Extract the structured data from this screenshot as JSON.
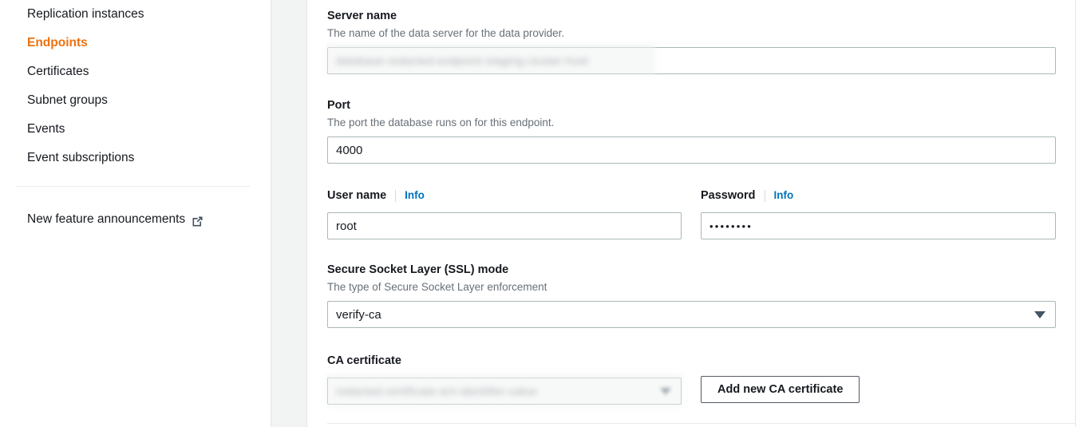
{
  "sidebar": {
    "items": [
      {
        "label": "Replication instances",
        "active": false
      },
      {
        "label": "Endpoints",
        "active": true
      },
      {
        "label": "Certificates",
        "active": false
      },
      {
        "label": "Subnet groups",
        "active": false
      },
      {
        "label": "Events",
        "active": false
      },
      {
        "label": "Event subscriptions",
        "active": false
      }
    ],
    "footer_link": {
      "label": "New feature announcements",
      "icon": "external-link-icon"
    },
    "active_color": "#ec7211"
  },
  "form": {
    "server_name": {
      "label": "Server name",
      "description": "The name of the data server for the data provider.",
      "value": "database-redacted-endpoint-staging-cluster-host",
      "redacted": true
    },
    "port": {
      "label": "Port",
      "description": "The port the database runs on for this endpoint.",
      "value": "4000",
      "redacted": false
    },
    "user_name": {
      "label": "User name",
      "info_label": "Info",
      "value": "root",
      "redacted": false
    },
    "password": {
      "label": "Password",
      "info_label": "Info",
      "value": "••••••••",
      "redacted": false
    },
    "ssl_mode": {
      "label": "Secure Socket Layer (SSL) mode",
      "description": "The type of Secure Socket Layer enforcement",
      "value": "verify-ca",
      "control": "dropdown"
    },
    "ca_certificate": {
      "label": "CA certificate",
      "value": "redacted-certificate-arn-identifier-value",
      "redacted": true,
      "control": "dropdown"
    },
    "add_ca_button": {
      "label": "Add new CA certificate"
    }
  },
  "colors": {
    "accent_orange": "#ec7211",
    "link_blue": "#0073bb",
    "label_text": "#16191f",
    "description_text": "#687078",
    "input_border": "#aab7b8",
    "gutter_bg": "#f2f3f3"
  }
}
